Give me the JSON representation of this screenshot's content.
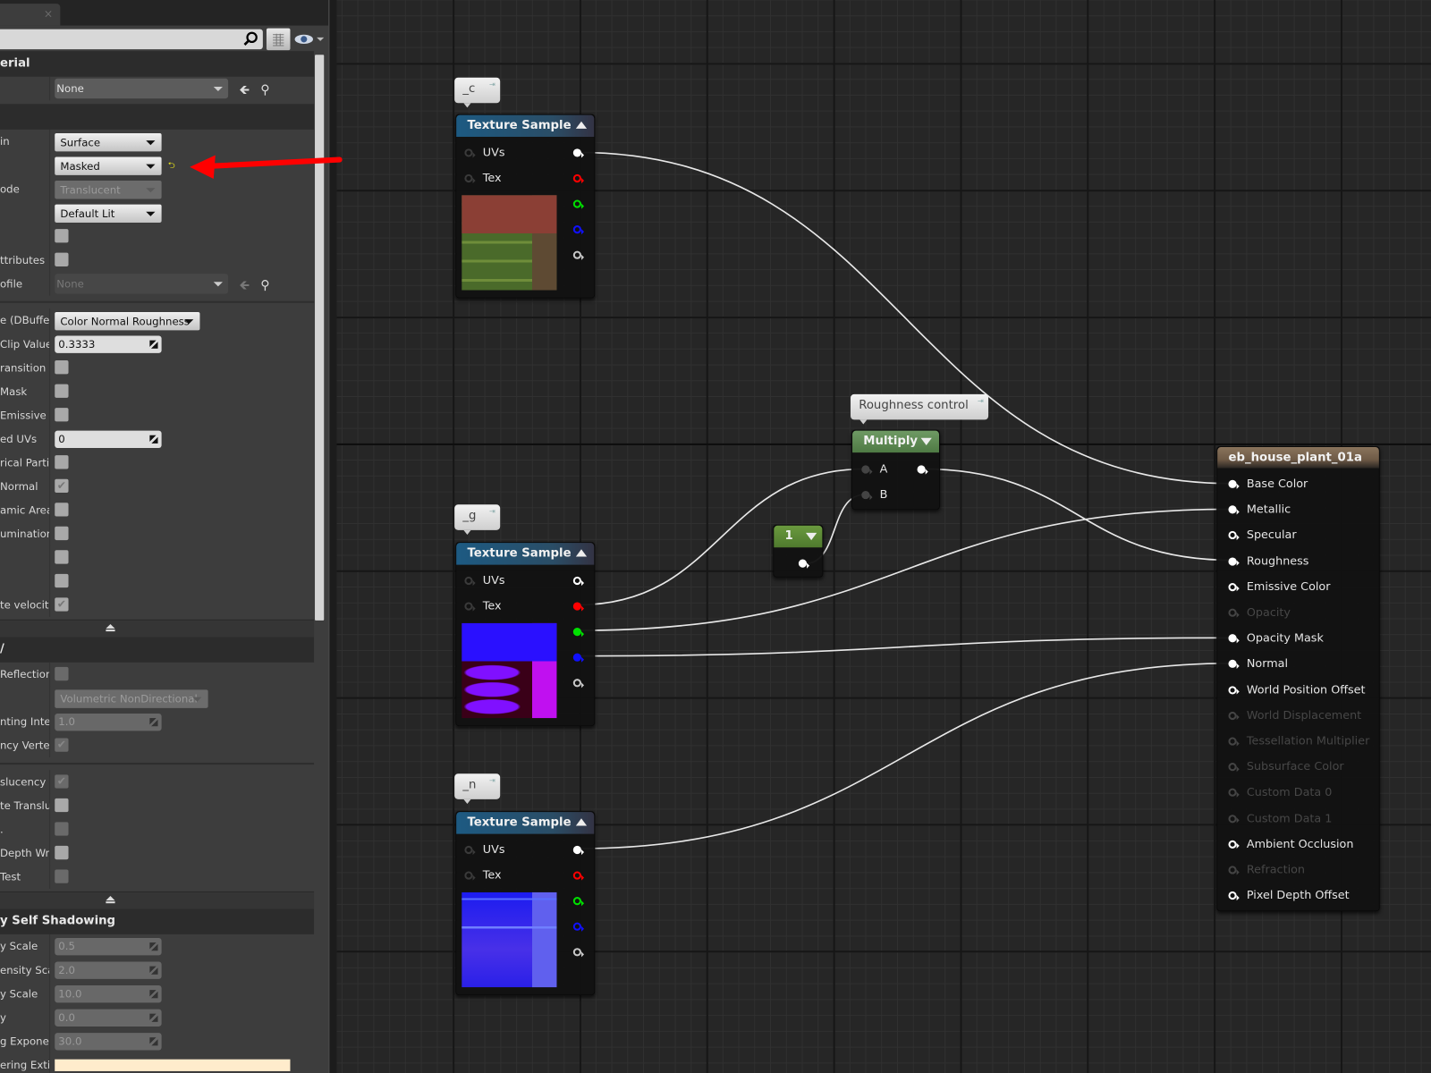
{
  "tab": {
    "close_label": "×"
  },
  "search": {
    "value": "",
    "placeholder": ""
  },
  "details": {
    "items": [
      {
        "kind": "header",
        "label": "erial"
      },
      {
        "kind": "row",
        "label": "",
        "control": "asset",
        "value": "None",
        "disabled": false
      },
      {
        "kind": "header",
        "label": ""
      },
      {
        "kind": "row",
        "label": "in",
        "control": "dropdown",
        "value": "Surface",
        "disabled": false
      },
      {
        "kind": "row",
        "label": "",
        "control": "dropdown",
        "value": "Masked",
        "disabled": false,
        "reset": "⮌"
      },
      {
        "kind": "row",
        "label": "ode",
        "control": "dropdown",
        "value": "Translucent",
        "disabled": true
      },
      {
        "kind": "row",
        "label": "",
        "control": "dropdown",
        "value": "Default Lit",
        "disabled": false
      },
      {
        "kind": "row",
        "label": "",
        "control": "checkbox",
        "checked": false,
        "disabled": false
      },
      {
        "kind": "row",
        "label": "ttributes",
        "control": "checkbox",
        "checked": false,
        "disabled": false
      },
      {
        "kind": "row",
        "label": "ofile",
        "control": "asset",
        "value": "None",
        "disabled": true
      },
      {
        "kind": "divider"
      },
      {
        "kind": "row",
        "label": "e (DBuffer",
        "control": "dropdown",
        "value": "Color Normal Roughness",
        "disabled": false,
        "wide": true
      },
      {
        "kind": "row",
        "label": "Clip Value",
        "control": "number",
        "value": "0.3333",
        "disabled": false
      },
      {
        "kind": "row",
        "label": "ransition",
        "control": "checkbox",
        "checked": false,
        "disabled": false
      },
      {
        "kind": "row",
        "label": " Mask",
        "control": "checkbox",
        "checked": false,
        "disabled": false
      },
      {
        "kind": "row",
        "label": " Emissive",
        "control": "checkbox",
        "checked": false,
        "disabled": false
      },
      {
        "kind": "row",
        "label": "ed UVs",
        "control": "number",
        "value": "0",
        "disabled": false
      },
      {
        "kind": "row",
        "label": "rical Parti",
        "control": "checkbox",
        "checked": false,
        "disabled": false
      },
      {
        "kind": "row",
        "label": " Normal",
        "control": "checkbox",
        "checked": true,
        "disabled": false
      },
      {
        "kind": "row",
        "label": "amic Area",
        "control": "checkbox",
        "checked": false,
        "disabled": false
      },
      {
        "kind": "row",
        "label": "umination",
        "control": "checkbox",
        "checked": false,
        "disabled": false
      },
      {
        "kind": "row",
        "label": "",
        "control": "checkbox",
        "checked": false,
        "disabled": false
      },
      {
        "kind": "row",
        "label": "",
        "control": "checkbox",
        "checked": false,
        "disabled": false
      },
      {
        "kind": "row",
        "label": "te velocit",
        "control": "checkbox",
        "checked": true,
        "disabled": false
      },
      {
        "kind": "collapse"
      },
      {
        "kind": "header",
        "label": "/"
      },
      {
        "kind": "row",
        "label": "Reflection",
        "control": "checkbox",
        "checked": false,
        "disabled": true
      },
      {
        "kind": "row",
        "label": "",
        "control": "dropdown",
        "value": "Volumetric NonDirectional",
        "disabled": true,
        "wider": true
      },
      {
        "kind": "row",
        "label": "nting Inter",
        "control": "number",
        "value": "1.0",
        "disabled": true
      },
      {
        "kind": "row",
        "label": "ncy Vertex",
        "control": "checkbox",
        "checked": true,
        "disabled": true
      },
      {
        "kind": "divider"
      },
      {
        "kind": "row",
        "label": "slucency",
        "control": "checkbox",
        "checked": true,
        "disabled": true
      },
      {
        "kind": "row",
        "label": "te Translu",
        "control": "checkbox",
        "checked": false,
        "disabled": false
      },
      {
        "kind": "row",
        "label": ".",
        "control": "checkbox",
        "checked": false,
        "disabled": true
      },
      {
        "kind": "row",
        "label": "Depth Writ",
        "control": "checkbox",
        "checked": false,
        "disabled": false
      },
      {
        "kind": "row",
        "label": "Test",
        "control": "checkbox",
        "checked": false,
        "disabled": true
      },
      {
        "kind": "collapse"
      },
      {
        "kind": "header",
        "label": "y Self Shadowing"
      },
      {
        "kind": "row",
        "label": "y Scale",
        "control": "number",
        "value": "0.5",
        "disabled": true
      },
      {
        "kind": "row",
        "label": "ensity Sca",
        "control": "number",
        "value": "2.0",
        "disabled": true
      },
      {
        "kind": "row",
        "label": "y Scale",
        "control": "number",
        "value": "10.0",
        "disabled": true
      },
      {
        "kind": "row",
        "label": "y",
        "control": "number",
        "value": "0.0",
        "disabled": true
      },
      {
        "kind": "row",
        "label": "g Exponent",
        "control": "number",
        "value": "30.0",
        "disabled": true
      },
      {
        "kind": "row",
        "label": "ering Extin",
        "control": "color",
        "value": "#ffeccc"
      }
    ]
  },
  "graph": {
    "texture_nodes": [
      {
        "comment": "_c",
        "title": "Texture Sample",
        "inputs": [
          "UVs",
          "Tex"
        ],
        "outputs_connected": [
          true,
          false,
          false,
          false,
          false
        ],
        "preview": "diffuse"
      },
      {
        "comment": "_g",
        "title": "Texture Sample",
        "inputs": [
          "UVs",
          "Tex"
        ],
        "outputs_connected": [
          false,
          true,
          true,
          true,
          false
        ],
        "preview": "packed"
      },
      {
        "comment": "_n",
        "title": "Texture Sample",
        "inputs": [
          "UVs",
          "Tex"
        ],
        "outputs_connected": [
          true,
          false,
          false,
          false,
          false
        ],
        "preview": "normal"
      }
    ],
    "output_pin_colors": [
      "#ffffff",
      "#ff0000",
      "#00e000",
      "#1010ff",
      "#c8c8c8"
    ],
    "multiply": {
      "comment": "Roughness control",
      "title": "Multiply",
      "inputs": [
        "A",
        "B"
      ]
    },
    "constant": {
      "title": "1"
    },
    "result": {
      "title": "eb_house_plant_01a",
      "pins": [
        {
          "label": "Base Color",
          "connected": true,
          "enabled": true
        },
        {
          "label": "Metallic",
          "connected": true,
          "enabled": true
        },
        {
          "label": "Specular",
          "connected": false,
          "enabled": true
        },
        {
          "label": "Roughness",
          "connected": true,
          "enabled": true
        },
        {
          "label": "Emissive Color",
          "connected": false,
          "enabled": true
        },
        {
          "label": "Opacity",
          "connected": false,
          "enabled": false
        },
        {
          "label": "Opacity Mask",
          "connected": true,
          "enabled": true
        },
        {
          "label": "Normal",
          "connected": true,
          "enabled": true
        },
        {
          "label": "World Position Offset",
          "connected": false,
          "enabled": true
        },
        {
          "label": "World Displacement",
          "connected": false,
          "enabled": false
        },
        {
          "label": "Tessellation Multiplier",
          "connected": false,
          "enabled": false
        },
        {
          "label": "Subsurface Color",
          "connected": false,
          "enabled": false
        },
        {
          "label": "Custom Data 0",
          "connected": false,
          "enabled": false
        },
        {
          "label": "Custom Data 1",
          "connected": false,
          "enabled": false
        },
        {
          "label": "Ambient Occlusion",
          "connected": false,
          "enabled": true
        },
        {
          "label": "Refraction",
          "connected": false,
          "enabled": false
        },
        {
          "label": "Pixel Depth Offset",
          "connected": false,
          "enabled": true
        }
      ]
    },
    "colors": {
      "texture_header": "#1d5a82",
      "math_header": "#4e7a44",
      "constant_header": "#4f7a2e",
      "result_header": "#6e5a46",
      "annotation_arrow": "#ff0000"
    }
  }
}
